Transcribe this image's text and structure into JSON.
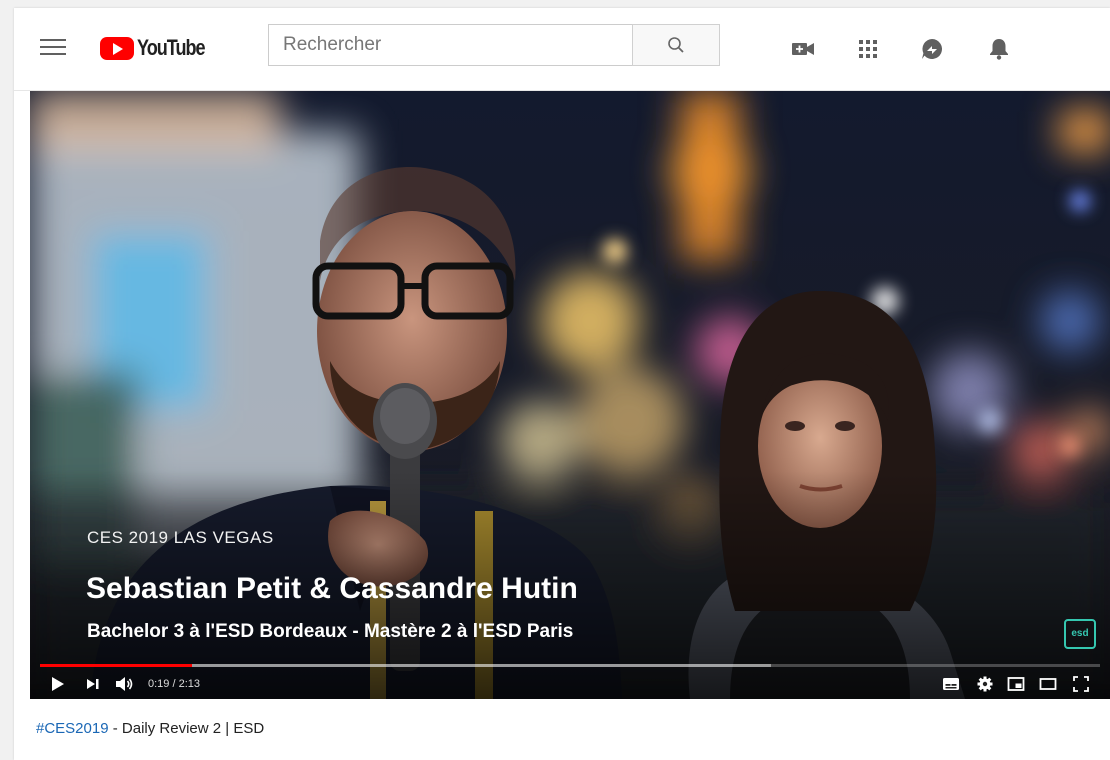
{
  "header": {
    "logo_text": "YouTube",
    "search_placeholder": "Rechercher"
  },
  "icons": [
    "menu-icon",
    "search-icon",
    "create-video-icon",
    "apps-grid-icon",
    "messages-icon",
    "notifications-bell-icon"
  ],
  "video": {
    "overlay_subtitle": "CES 2019 LAS VEGAS",
    "overlay_names": "Sebastian Petit & Cassandre Hutin",
    "overlay_school": "Bachelor 3 à l'ESD Bordeaux - Mastère 2 à l'ESD Paris",
    "brand_badge": "esd",
    "time_display": "0:19 / 2:13",
    "progress_played_fraction": 0.143,
    "progress_loaded_fraction": 0.69
  },
  "caption": {
    "hashtag": "#CES2019",
    "rest": " - Daily Review 2 | ESD"
  },
  "colors": {
    "accent_red": "#ff0000",
    "link_blue": "#1a67b5",
    "esd_teal": "#35c7b0"
  }
}
